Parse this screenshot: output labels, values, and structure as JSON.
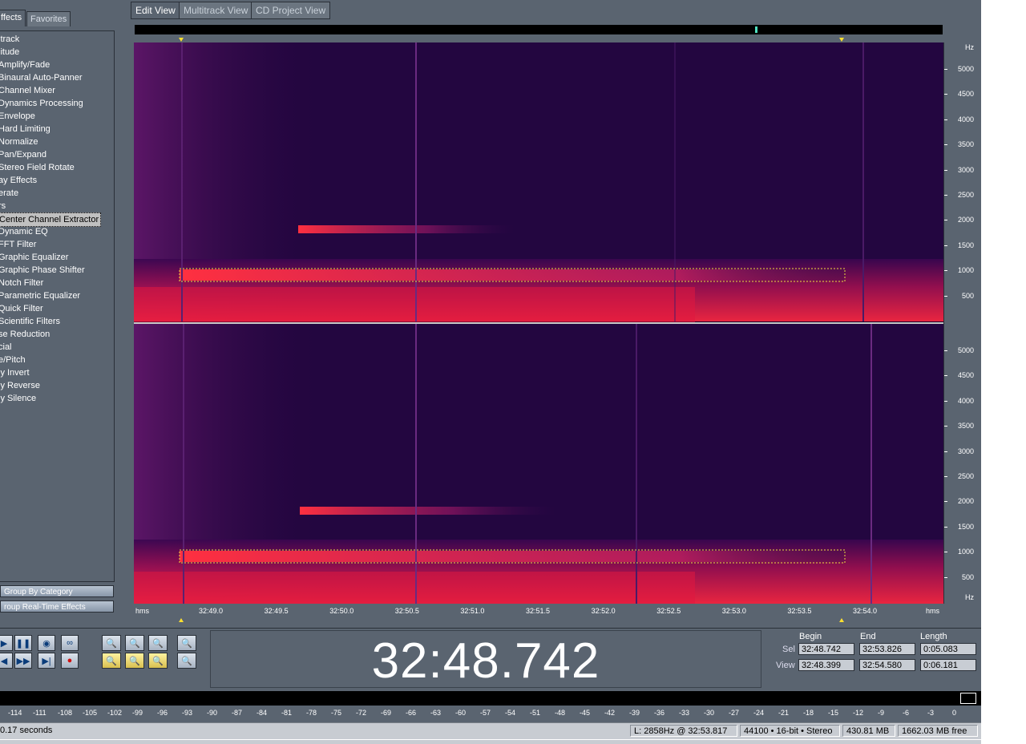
{
  "left_panel": {
    "tabs": [
      "ffects",
      "Favorites"
    ],
    "tree_items": [
      "itrack",
      "litude",
      "Amplify/Fade",
      "Binaural Auto-Panner",
      "Channel Mixer",
      "Dynamics Processing",
      "Envelope",
      "Hard Limiting",
      "Normalize",
      "Pan/Expand",
      "Stereo Field Rotate",
      "ay Effects",
      "erate",
      "rs",
      "Center Channel Extractor",
      "Dynamic EQ",
      "FFT Filter",
      "Graphic Equalizer",
      "Graphic Phase Shifter",
      "Notch Filter",
      "Parametric Equalizer",
      "Quick Filter",
      "Scientific Filters",
      "se Reduction",
      "cial",
      "e/Pitch",
      "ly Invert",
      "ly Reverse",
      "ly Silence"
    ],
    "selected_index": 14,
    "group_by_category": "Group By Category",
    "group_realtime": "roup Real-Time Effects"
  },
  "view_tabs": [
    "Edit View",
    "Multitrack View",
    "CD Project View"
  ],
  "freq_axis": {
    "unit": "Hz",
    "labels": [
      "5000",
      "4500",
      "4000",
      "3500",
      "3000",
      "2500",
      "2000",
      "1500",
      "1000",
      "500"
    ]
  },
  "time_axis": {
    "unit": "hms",
    "labels": [
      "32:49.0",
      "32:49.5",
      "32:50.0",
      "32:50.5",
      "32:51.0",
      "32:51.5",
      "32:52.0",
      "32:52.5",
      "32:53.0",
      "32:53.5",
      "32:54.0"
    ]
  },
  "transport": {
    "current_time": "32:48.742"
  },
  "selection": {
    "headers": {
      "begin": "Begin",
      "end": "End",
      "length": "Length"
    },
    "sel": {
      "label": "Sel",
      "begin": "32:48.742",
      "end": "32:53.826",
      "length": "0:05.083"
    },
    "view": {
      "label": "View",
      "begin": "32:48.399",
      "end": "32:54.580",
      "length": "0:06.181"
    }
  },
  "level_meter": {
    "labels": [
      "-114",
      "-111",
      "-108",
      "-105",
      "-102",
      "-99",
      "-96",
      "-93",
      "-90",
      "-87",
      "-84",
      "-81",
      "-78",
      "-75",
      "-72",
      "-69",
      "-66",
      "-63",
      "-60",
      "-57",
      "-54",
      "-51",
      "-48",
      "-45",
      "-42",
      "-39",
      "-36",
      "-33",
      "-30",
      "-27",
      "-24",
      "-21",
      "-18",
      "-15",
      "-12",
      "-9",
      "-6",
      "-3",
      "0"
    ]
  },
  "status_bar": {
    "left": "0.17 seconds",
    "cursor": "L: 2858Hz @  32:53.817",
    "format": "44100 • 16-bit • Stereo",
    "size": "430.81 MB",
    "free": "1662.03 MB free"
  },
  "colors": {
    "background": "#12002a",
    "panel": "#5a6470",
    "spectral_hot": "#ff2040"
  }
}
